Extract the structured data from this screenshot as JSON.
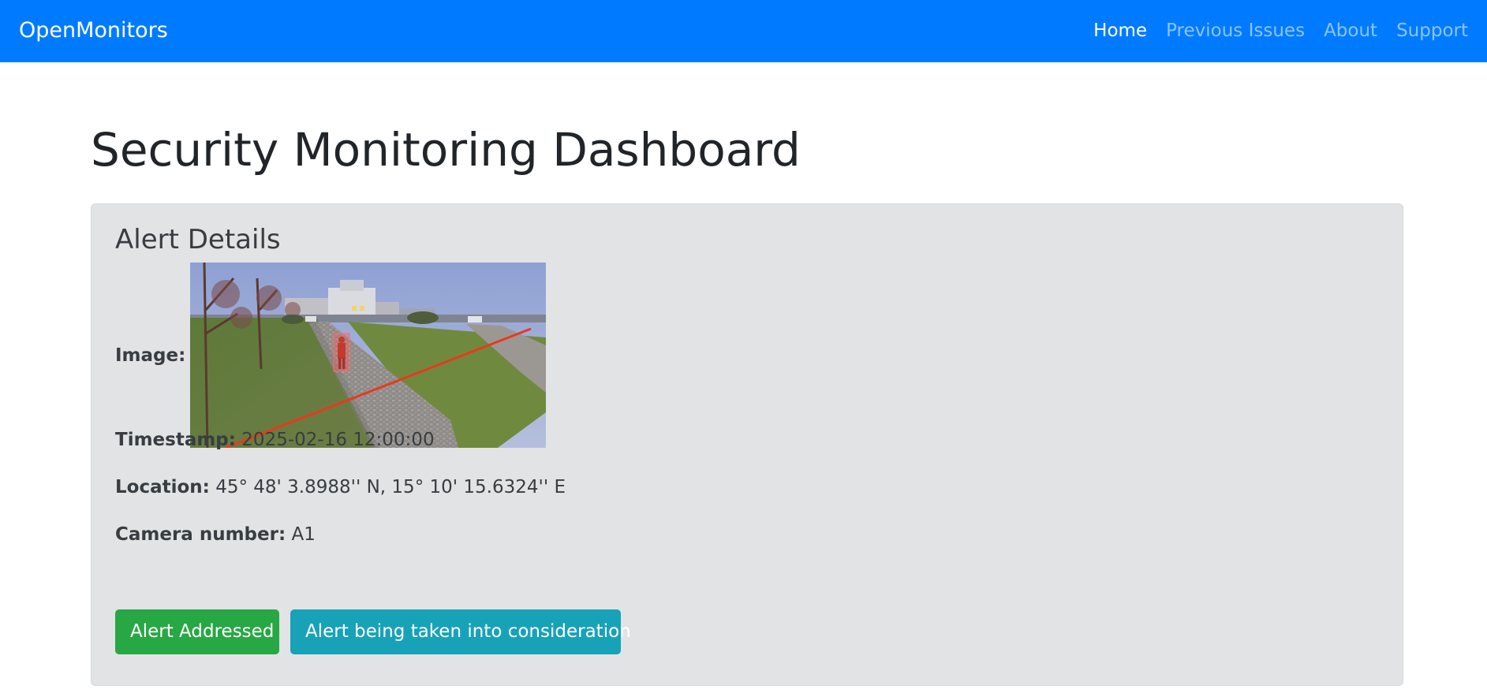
{
  "navbar": {
    "brand": "OpenMonitors",
    "links": [
      {
        "label": "Home",
        "active": true
      },
      {
        "label": "Previous Issues",
        "active": false
      },
      {
        "label": "About",
        "active": false
      },
      {
        "label": "Support",
        "active": false
      }
    ]
  },
  "page": {
    "title": "Security Monitoring Dashboard"
  },
  "alert": {
    "heading": "Alert Details",
    "image_label": "Image:",
    "timestamp_label": "Timestamp:",
    "timestamp_value": "2025-02-16 12:00:00",
    "location_label": "Location:",
    "location_value": "45° 48' 3.8988'' N, 15° 10' 15.6324'' E",
    "camera_label": "Camera number:",
    "camera_value": "A1"
  },
  "actions": {
    "addressed_label": "Alert Addressed",
    "consideration_label": "Alert being taken into consideration"
  },
  "colors": {
    "navbar": "#007bff",
    "card_bg": "#e2e3e5",
    "success": "#28a745",
    "info": "#17a2b8",
    "detection_line": "#e8391e"
  }
}
